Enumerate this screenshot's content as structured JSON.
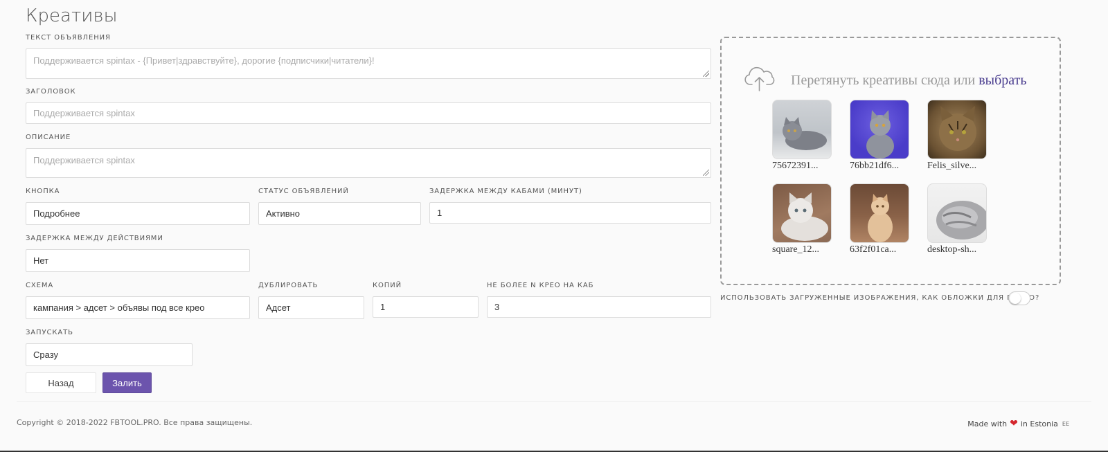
{
  "page_title": "Креативы",
  "form": {
    "ad_text": {
      "label": "Текст объявления",
      "placeholder": "Поддерживается spintax - {Привет|здравствуйте}, дорогие {подписчики|читатели}!"
    },
    "headline": {
      "label": "Заголовок",
      "placeholder": "Поддерживается spintax"
    },
    "description": {
      "label": "Описание",
      "placeholder": "Поддерживается spintax"
    },
    "button": {
      "label": "Кнопка",
      "value": "Подробнее"
    },
    "ad_status": {
      "label": "Статус объявлений",
      "value": "Активно"
    },
    "delay_cabinets": {
      "label": "Задержка между кабами (минут)",
      "value": "1"
    },
    "delay_actions": {
      "label": "Задержка между действиями",
      "value": "Нет"
    },
    "scheme": {
      "label": "Схема",
      "value": "кампания > адсет > объявы под все крео"
    },
    "duplicate": {
      "label": "Дублировать",
      "value": "Адсет"
    },
    "copies": {
      "label": "Копий",
      "value": "1"
    },
    "max_creatives": {
      "label": "Не более N крео на каб",
      "value": "3"
    },
    "launch": {
      "label": "Запускать",
      "value": "Сразу"
    }
  },
  "buttons": {
    "back": "Назад",
    "submit": "Залить"
  },
  "dropzone": {
    "text": "Перетянуть креативы сюда или ",
    "pick_link": "выбрать",
    "icon": "cloud-upload-icon",
    "files": [
      {
        "name": "75672391..."
      },
      {
        "name": "76bb21df6..."
      },
      {
        "name": "Felis_silve..."
      },
      {
        "name": "square_12..."
      },
      {
        "name": "63f2f01ca..."
      },
      {
        "name": "desktop-sh..."
      }
    ]
  },
  "toggle": {
    "label": "Использовать загруженные изображения, как обложки для видео?",
    "enabled": false
  },
  "footer": {
    "copyright": "Copyright © 2018-2022 FBTOOL.PRO. Все права защищены.",
    "made_with": "Made with",
    "in_country": "in Estonia",
    "flag_code": "EE"
  },
  "colors": {
    "accent": "#6c54ad",
    "link": "#4a3d8f",
    "heart": "#d4262d"
  }
}
